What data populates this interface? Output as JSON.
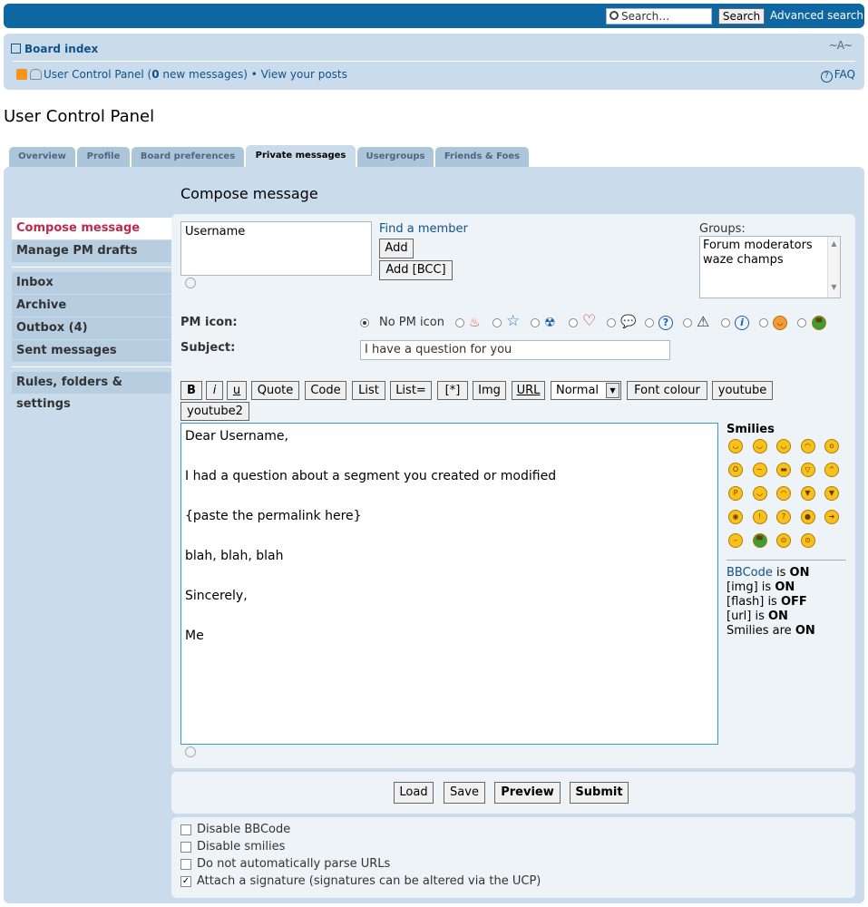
{
  "header": {
    "search_placeholder": "Search…",
    "search_button": "Search",
    "advanced_search": "Advanced search"
  },
  "nav": {
    "board_index": "Board index",
    "font_size": "~A~",
    "ucp": "User Control Panel (",
    "new_count": "0",
    "new_messages": " new messages)",
    "bullet": " • ",
    "view_posts": "View your posts",
    "faq": "FAQ"
  },
  "page": {
    "title": "User Control Panel"
  },
  "tabs": [
    {
      "label": "Overview"
    },
    {
      "label": "Profile"
    },
    {
      "label": "Board preferences"
    },
    {
      "label": "Private messages"
    },
    {
      "label": "Usergroups"
    },
    {
      "label": "Friends & Foes"
    }
  ],
  "section_title": "Compose message",
  "sidebar": [
    {
      "label": "Compose message"
    },
    {
      "label": "Manage PM drafts"
    },
    {
      "label": "Inbox"
    },
    {
      "label": "Archive"
    },
    {
      "label": "Outbox (4)"
    },
    {
      "label": "Sent messages"
    },
    {
      "label": "Rules, folders & settings"
    }
  ],
  "compose": {
    "recipient": "Username",
    "find_member": "Find a member",
    "add": "Add",
    "add_bcc": "Add [BCC]",
    "groups_label": "Groups:",
    "groups": [
      "Forum moderators",
      "waze champs"
    ],
    "pm_icon_label": "PM icon:",
    "no_pm_icon": "No PM icon",
    "pm_icons": [
      "fire-icon",
      "star-icon",
      "radioactive-icon",
      "heart-icon",
      "speech-bubble-icon",
      "question-icon",
      "warning-icon",
      "info-icon",
      "wink-face-icon",
      "grin-face-icon"
    ],
    "subject_label": "Subject:",
    "subject": "I have a question for you"
  },
  "toolbar": {
    "b": "B",
    "i": "i",
    "u": "u",
    "quote": "Quote",
    "code": "Code",
    "list": "List",
    "list_eq": "List=",
    "li": "[*]",
    "img": "Img",
    "url": "URL",
    "size": "Normal",
    "font_colour": "Font colour",
    "youtube": "youtube",
    "youtube2": "youtube2"
  },
  "message": {
    "lines": [
      "Dear Username,",
      "",
      "I had a question about a segment you created or modified",
      "",
      "{paste the permalink here}",
      "",
      "blah, blah, blah",
      "",
      "Sincerely,",
      "",
      "Me"
    ]
  },
  "smilies": {
    "title": "Smilies",
    "items": [
      "biggrin",
      "smile",
      "wink",
      "sad",
      "surprised",
      "eek",
      "confused",
      "cool",
      "lol",
      "mad",
      "razz",
      "redface",
      "cry",
      "evil",
      "twisted",
      "rolleyes",
      "exclaim",
      "question",
      "idea",
      "arrow",
      "neutral",
      "mrgreen",
      "geek",
      "uber-geek"
    ]
  },
  "bbinfo": {
    "bbcode": "BBCode",
    "is": " is ",
    "bbcode_state": "ON",
    "img": "[img] is ",
    "img_state": "ON",
    "flash": "[flash] is ",
    "flash_state": "OFF",
    "url": "[url] is ",
    "url_state": "ON",
    "smilies": "Smilies are ",
    "smilies_state": "ON"
  },
  "actions": {
    "load": "Load",
    "save": "Save",
    "preview": "Preview",
    "submit": "Submit"
  },
  "options": [
    {
      "label": "Disable BBCode",
      "checked": false
    },
    {
      "label": "Disable smilies",
      "checked": false
    },
    {
      "label": "Do not automatically parse URLs",
      "checked": false
    },
    {
      "label": "Attach a signature (signatures can be altered via the UCP)",
      "checked": true
    }
  ]
}
